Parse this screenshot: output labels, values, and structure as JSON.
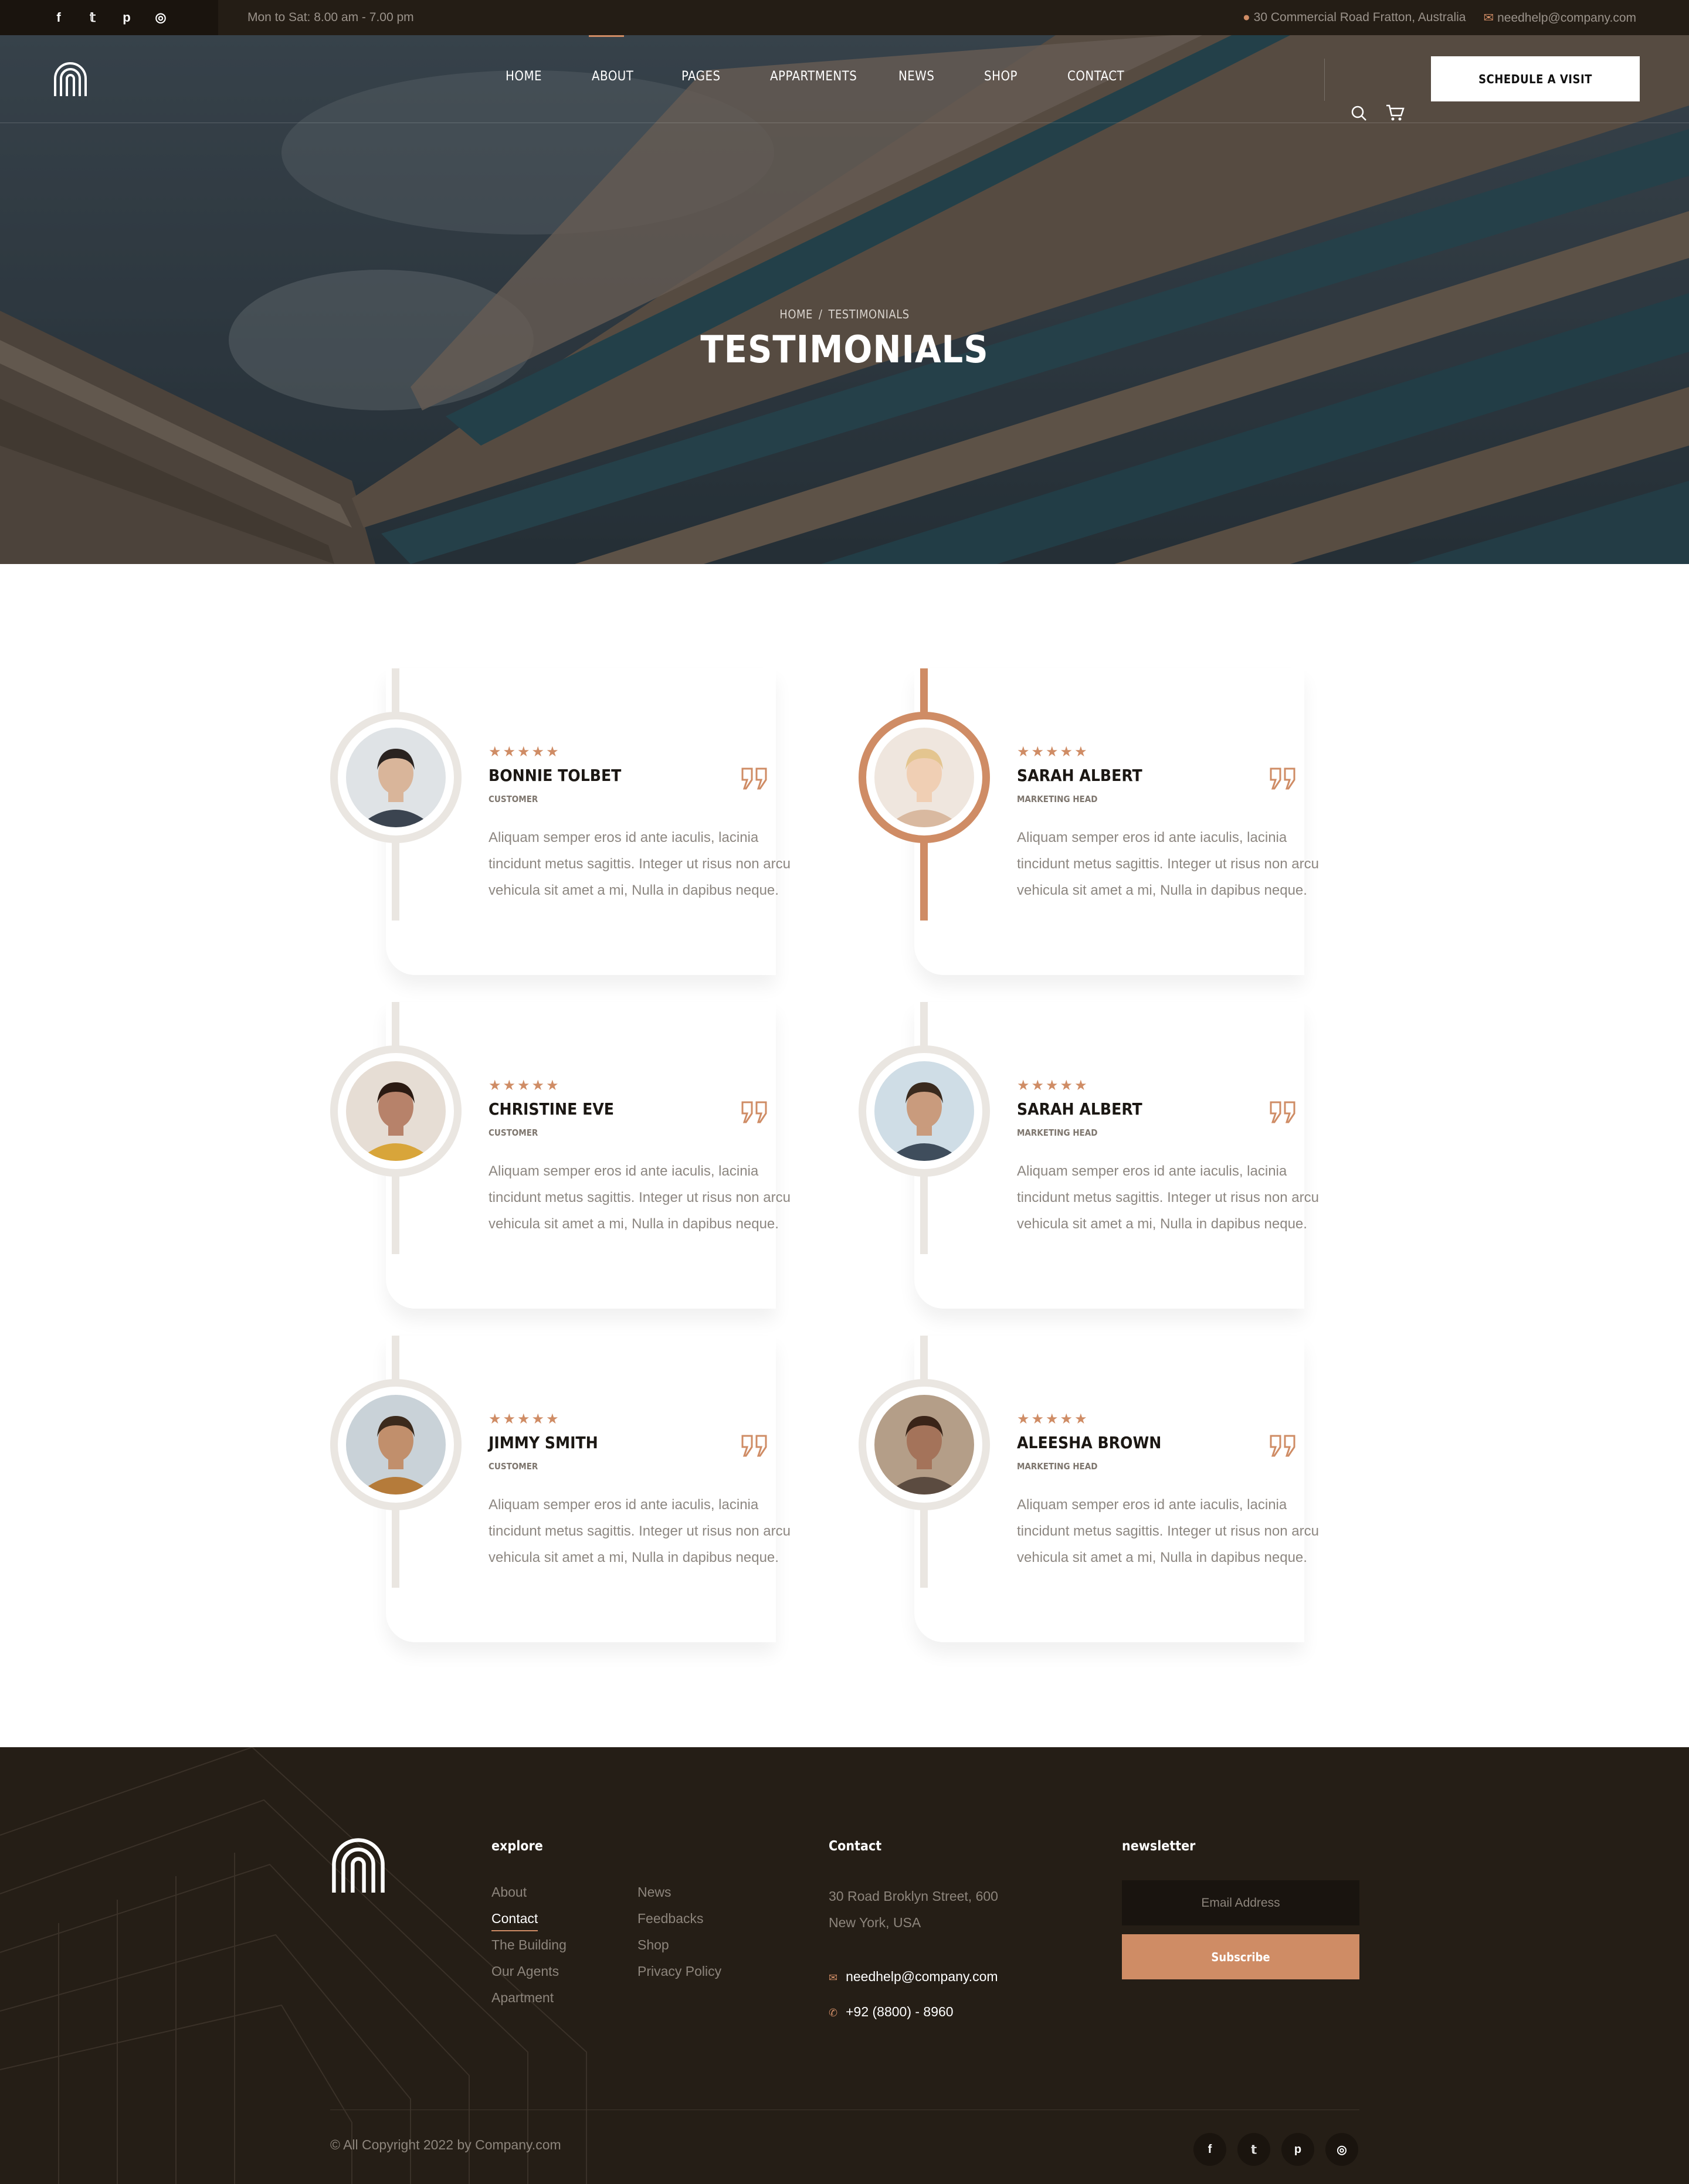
{
  "topbar": {
    "social": [
      {
        "icon": "facebook-icon",
        "glyph": "f"
      },
      {
        "icon": "twitter-icon",
        "glyph": "𝕥"
      },
      {
        "icon": "pinterest-icon",
        "glyph": "p"
      },
      {
        "icon": "instagram-icon",
        "glyph": "◎"
      }
    ],
    "hours": "Mon to Sat: 8.00 am - 7.00 pm",
    "address": "30 Commercial Road Fratton, Australia",
    "email": "needhelp@company.com"
  },
  "nav": {
    "items": [
      "Home",
      "About",
      "Pages",
      "Appartments",
      "News",
      "Shop",
      "Contact"
    ],
    "active": "About",
    "cta": "Schedule a Visit"
  },
  "hero": {
    "breadcrumb_home": "Home",
    "breadcrumb_sep": "/",
    "breadcrumb_current": "Testimonials",
    "title": "TESTIMONIALS"
  },
  "testimonials": [
    {
      "name": "Bonnie Tolbet",
      "role": "Customer",
      "rating": 5,
      "text": "Aliquam semper eros id ante iaculis, lacinia tincidunt metus sagittis. Integer ut risus non arcu vehicula sit amet a mi, Nulla in dapibus neque.",
      "featured": false
    },
    {
      "name": "Sarah Albert",
      "role": "Marketing Head",
      "rating": 5,
      "text": "Aliquam semper eros id ante iaculis, lacinia tincidunt metus sagittis. Integer ut risus non arcu vehicula sit amet a mi, Nulla in dapibus neque.",
      "featured": true
    },
    {
      "name": "Christine Eve",
      "role": "Customer",
      "rating": 5,
      "text": "Aliquam semper eros id ante iaculis, lacinia tincidunt metus sagittis. Integer ut risus non arcu vehicula sit amet a mi, Nulla in dapibus neque.",
      "featured": false
    },
    {
      "name": "Sarah Albert",
      "role": "Marketing Head",
      "rating": 5,
      "text": "Aliquam semper eros id ante iaculis, lacinia tincidunt metus sagittis. Integer ut risus non arcu vehicula sit amet a mi, Nulla in dapibus neque.",
      "featured": false
    },
    {
      "name": "Jimmy Smith",
      "role": "Customer",
      "rating": 5,
      "text": "Aliquam semper eros id ante iaculis, lacinia tincidunt metus sagittis. Integer ut risus non arcu vehicula sit amet a mi, Nulla in dapibus neque.",
      "featured": false
    },
    {
      "name": "Aleesha Brown",
      "role": "Marketing Head",
      "rating": 5,
      "text": "Aliquam semper eros id ante iaculis, lacinia tincidunt metus sagittis. Integer ut risus non arcu vehicula sit amet a mi, Nulla in dapibus neque.",
      "featured": false
    }
  ],
  "footer": {
    "explore_title": "explore",
    "explore_col1": [
      "About",
      "Contact",
      "The Building",
      "Our Agents",
      "Apartment"
    ],
    "explore_col2": [
      "News",
      "Feedbacks",
      "Shop",
      "Privacy Policy"
    ],
    "explore_active": "Contact",
    "contact_title": "Contact",
    "contact_address_line1": "30 Road Broklyn Street, 600",
    "contact_address_line2": "New York, USA",
    "contact_email": "needhelp@company.com",
    "contact_phone": "+92 (8800) - 8960",
    "newsletter_title": "newsletter",
    "newsletter_placeholder": "Email Address",
    "newsletter_button": "Subscribe",
    "copyright": "© All Copyright 2022 by Company.com",
    "social": [
      {
        "icon": "facebook-icon",
        "glyph": "f"
      },
      {
        "icon": "twitter-icon",
        "glyph": "𝕥"
      },
      {
        "icon": "pinterest-icon",
        "glyph": "p"
      },
      {
        "icon": "instagram-icon",
        "glyph": "◎"
      }
    ]
  },
  "colors": {
    "accent": "#cf8c65",
    "dark": "#251e16",
    "topbar": "#241d15"
  }
}
